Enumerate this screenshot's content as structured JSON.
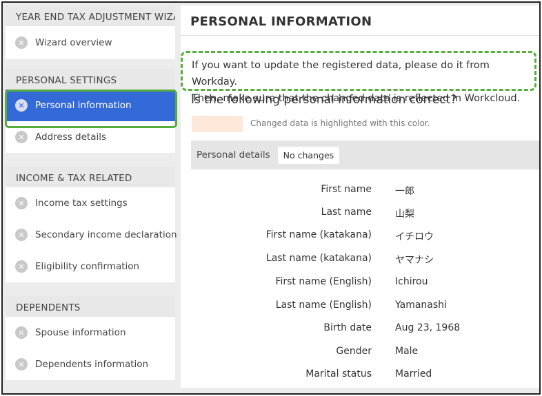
{
  "sidebar": {
    "sections": [
      {
        "header": "YEAR END TAX ADJUSTMENT WIZARD",
        "items": [
          {
            "label": "Wizard overview",
            "icon": "x-circle-icon"
          }
        ]
      },
      {
        "header": "PERSONAL SETTINGS",
        "items": [
          {
            "label": "Personal information",
            "icon": "x-circle-icon",
            "active": true
          },
          {
            "label": "Address details",
            "icon": "x-circle-icon"
          }
        ]
      },
      {
        "header": "INCOME & TAX RELATED",
        "items": [
          {
            "label": "Income tax settings",
            "icon": "x-circle-icon"
          },
          {
            "label": "Secondary income declaration",
            "icon": "x-circle-icon"
          },
          {
            "label": "Eligibility confirmation",
            "icon": "x-circle-icon"
          }
        ]
      },
      {
        "header": "DEPENDENTS",
        "items": [
          {
            "label": "Spouse information",
            "icon": "x-circle-icon"
          },
          {
            "label": "Dependents information",
            "icon": "x-circle-icon"
          }
        ]
      }
    ]
  },
  "main": {
    "title": "PERSONAL INFORMATION",
    "notice_line1": "If you want to update the registered data, please do it from Workday.",
    "notice_line2": "Then, make sure that the changed data is reflected in Workcloud.",
    "question": "Is the following personal information correct?",
    "legend_text": "Changed data is highlighted with this color.",
    "details_label": "Personal details",
    "details_badge": "No changes",
    "fields": [
      {
        "label": "First name",
        "value": "一郎"
      },
      {
        "label": "Last name",
        "value": "山梨"
      },
      {
        "label": "First name (katakana)",
        "value": "イチロウ"
      },
      {
        "label": "Last name (katakana)",
        "value": "ヤマナシ"
      },
      {
        "label": "First name (English)",
        "value": "Ichirou"
      },
      {
        "label": "Last name (English)",
        "value": "Yamanashi"
      },
      {
        "label": "Birth date",
        "value": "Aug 23, 1968"
      },
      {
        "label": "Gender",
        "value": "Male"
      },
      {
        "label": "Marital status",
        "value": "Married"
      }
    ]
  },
  "colors": {
    "active": "#3469d8",
    "highlight_outline": "#56ad3b",
    "changed_swatch": "#fde8da"
  }
}
